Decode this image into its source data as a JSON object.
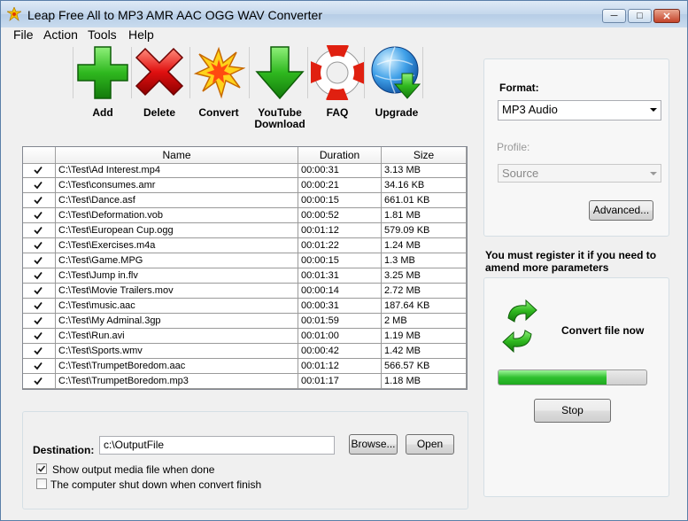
{
  "window": {
    "title": "Leap Free All to MP3 AMR AAC OGG WAV Converter",
    "controls": {
      "minimize": "─",
      "maximize": "□",
      "close": "✕"
    }
  },
  "menu": [
    "File",
    "Action",
    "Tools",
    "Help"
  ],
  "toolbar": [
    {
      "label": "Add",
      "icon": "add-plus-icon"
    },
    {
      "label": "Delete",
      "icon": "delete-x-icon"
    },
    {
      "label": "Convert",
      "icon": "convert-burst-icon"
    },
    {
      "label": "YouTube Download",
      "icon": "download-arrow-icon"
    },
    {
      "label": "FAQ",
      "icon": "lifebuoy-icon"
    },
    {
      "label": "Upgrade",
      "icon": "globe-upgrade-icon"
    }
  ],
  "file_list": {
    "columns": [
      "",
      "Name",
      "Duration",
      "Size"
    ],
    "rows": [
      {
        "checked": true,
        "name": "C:\\Test\\Ad Interest.mp4",
        "duration": "00:00:31",
        "size": "3.13 MB"
      },
      {
        "checked": true,
        "name": "C:\\Test\\consumes.amr",
        "duration": "00:00:21",
        "size": "34.16 KB"
      },
      {
        "checked": true,
        "name": "C:\\Test\\Dance.asf",
        "duration": "00:00:15",
        "size": "661.01 KB"
      },
      {
        "checked": true,
        "name": "C:\\Test\\Deformation.vob",
        "duration": "00:00:52",
        "size": "1.81 MB"
      },
      {
        "checked": true,
        "name": "C:\\Test\\European Cup.ogg",
        "duration": "00:01:12",
        "size": "579.09 KB"
      },
      {
        "checked": true,
        "name": "C:\\Test\\Exercises.m4a",
        "duration": "00:01:22",
        "size": "1.24 MB"
      },
      {
        "checked": true,
        "name": "C:\\Test\\Game.MPG",
        "duration": "00:00:15",
        "size": "1.3 MB"
      },
      {
        "checked": true,
        "name": "C:\\Test\\Jump in.flv",
        "duration": "00:01:31",
        "size": "3.25 MB"
      },
      {
        "checked": true,
        "name": "C:\\Test\\Movie Trailers.mov",
        "duration": "00:00:14",
        "size": "2.72 MB"
      },
      {
        "checked": true,
        "name": "C:\\Test\\music.aac",
        "duration": "00:00:31",
        "size": "187.64 KB"
      },
      {
        "checked": true,
        "name": "C:\\Test\\My Adminal.3gp",
        "duration": "00:01:59",
        "size": "2 MB"
      },
      {
        "checked": true,
        "name": "C:\\Test\\Run.avi",
        "duration": "00:01:00",
        "size": "1.19 MB"
      },
      {
        "checked": true,
        "name": "C:\\Test\\Sports.wmv",
        "duration": "00:00:42",
        "size": "1.42 MB"
      },
      {
        "checked": true,
        "name": "C:\\Test\\TrumpetBoredom.aac",
        "duration": "00:01:12",
        "size": "566.57 KB"
      },
      {
        "checked": true,
        "name": "C:\\Test\\TrumpetBoredom.mp3",
        "duration": "00:01:17",
        "size": "1.18 MB"
      }
    ]
  },
  "output": {
    "destination_label": "Destination:",
    "destination_value": "c:\\OutputFile",
    "browse_label": "Browse...",
    "open_label": "Open",
    "show_output_label": "Show output media file when done",
    "show_output_checked": true,
    "shutdown_label": "The computer shut down when convert finish",
    "shutdown_checked": false
  },
  "settings": {
    "format_label": "Format:",
    "format_value": "MP3 Audio",
    "profile_label": "Profile:",
    "profile_value": "Source",
    "advanced_label": "Advanced...",
    "register_notice": "You must register it if you need to amend more parameters"
  },
  "convert_panel": {
    "status_text": "Convert file now",
    "icon": "refresh-arrows-icon",
    "progress": 0.73,
    "stop_label": "Stop"
  },
  "colors": {
    "accent_green": "#2fc02f",
    "delete_red": "#d40000",
    "titlebar": "#c4d7ec"
  }
}
